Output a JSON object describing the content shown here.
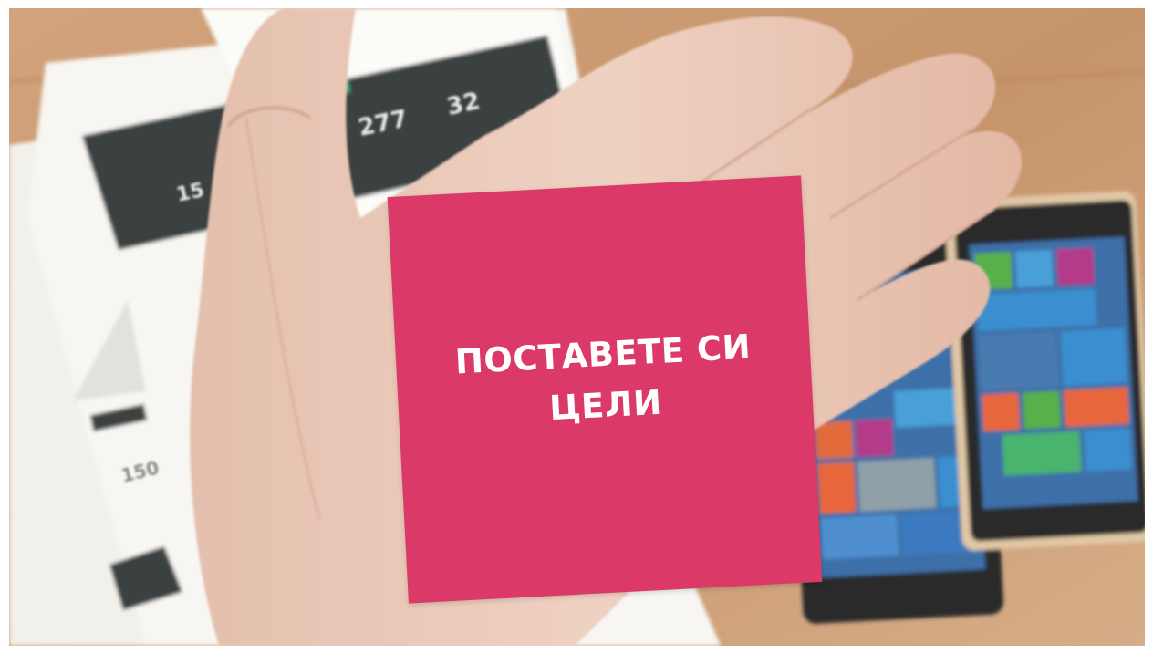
{
  "card": {
    "text_line1": "ПОСТАВЕТЕ СИ",
    "text_line2": "ЦЕЛИ"
  },
  "colors": {
    "card": "#db3a68",
    "table": "#c89870",
    "skin": "#e9c7b6"
  },
  "documents": {
    "stat_a": "277",
    "stat_b": "32",
    "stat_c": "150",
    "stat_d": "15"
  }
}
